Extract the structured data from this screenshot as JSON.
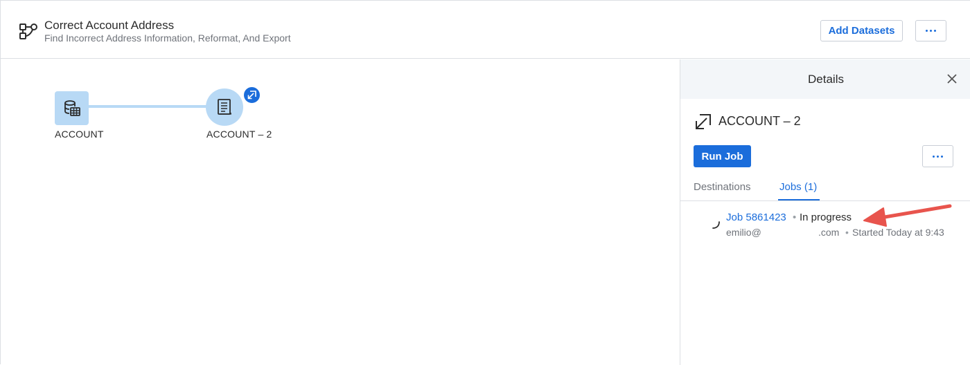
{
  "header": {
    "flow_icon": "flow-icon",
    "title": "Correct Account Address",
    "subtitle": "Find Incorrect Address Information, Reformat, And Export",
    "add_datasets_label": "Add Datasets",
    "more_icon": "more-horizontal-icon"
  },
  "canvas": {
    "nodes": [
      {
        "label": "ACCOUNT",
        "icon": "dataset-icon"
      },
      {
        "label": "ACCOUNT – 2",
        "icon": "output-icon",
        "badge_icon": "destination-icon"
      }
    ]
  },
  "details": {
    "title": "Details",
    "close_icon": "close-icon",
    "destination_icon": "destination-icon",
    "destination_name": "ACCOUNT – 2",
    "run_job_label": "Run Job",
    "tabs": [
      {
        "label": "Destinations",
        "active": false
      },
      {
        "label": "Jobs (1)",
        "active": true
      }
    ],
    "job": {
      "spinner_icon": "loading-spinner-icon",
      "link": "Job 5861423",
      "sep": "•",
      "status": "In progress",
      "user": "emilio@",
      "domain": ".com",
      "started": "Started Today at 9:43"
    }
  },
  "annotation": {
    "icon": "red-arrow-annotation"
  },
  "colors": {
    "accent": "#1b6ddb",
    "node_fill": "#b8d9f5",
    "panel_header": "#f3f6f9",
    "annotation": "#e8544d"
  }
}
